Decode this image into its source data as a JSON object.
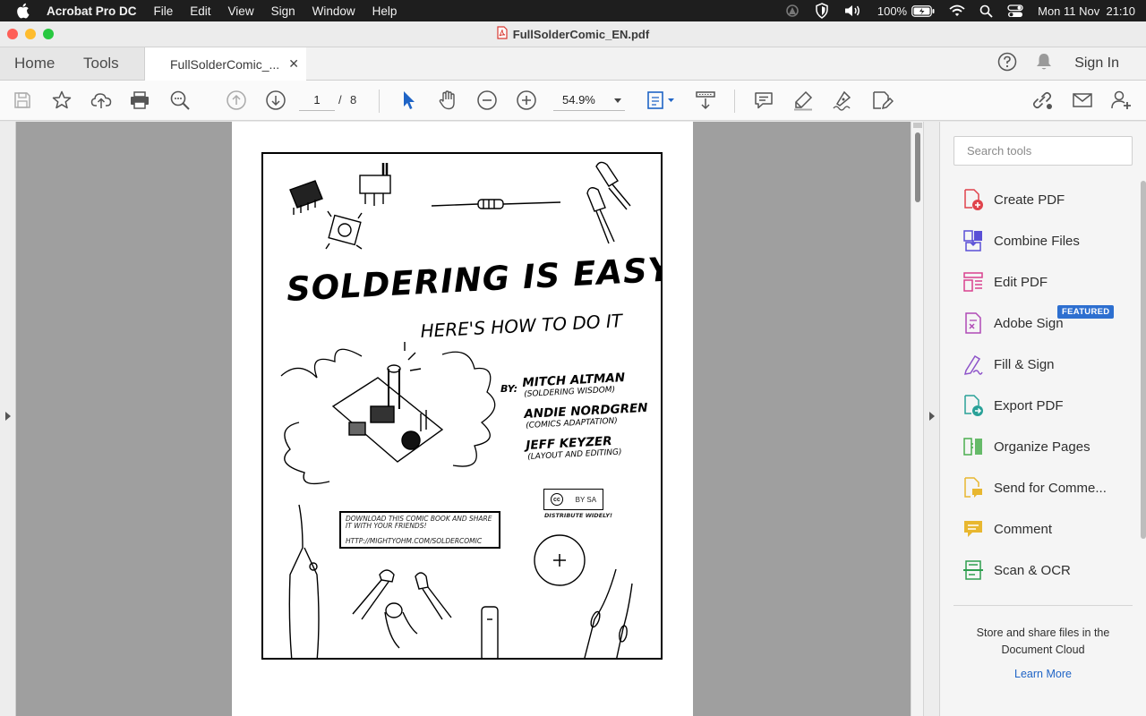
{
  "menubar": {
    "app_name": "Acrobat Pro DC",
    "items": [
      "File",
      "Edit",
      "View",
      "Sign",
      "Window",
      "Help"
    ],
    "battery": "100%",
    "datetime": "Mon 11 Nov  21:10"
  },
  "window": {
    "title": "FullSolderComic_EN.pdf"
  },
  "tabs": {
    "home": "Home",
    "tools": "Tools",
    "document": "FullSolderComic_...",
    "sign_in": "Sign In"
  },
  "toolbar": {
    "page_current": "1",
    "page_separator": "/",
    "page_total": "8",
    "zoom": "54.9%"
  },
  "document": {
    "title": "SOLDERING IS EASY",
    "subtitle": "HERE'S HOW TO DO IT",
    "by": "BY:",
    "credits": [
      {
        "name": "MITCH ALTMAN",
        "role": "(SOLDERING WISDOM)"
      },
      {
        "name": "ANDIE NORDGREN",
        "role": "(COMICS ADAPTATION)"
      },
      {
        "name": "JEFF KEYZER",
        "role": "(LAYOUT AND EDITING)"
      }
    ],
    "download_text": "DOWNLOAD THIS COMIC BOOK AND SHARE IT WITH YOUR FRIENDS!",
    "download_url": "HTTP://MIGHTYOHM.COM/SOLDERCOMIC",
    "cc_label": "BY   SA",
    "distribute": "DISTRIBUTE WIDELY!"
  },
  "tools_pane": {
    "search_placeholder": "Search tools",
    "items": [
      {
        "label": "Create PDF",
        "icon": "create-pdf-icon",
        "color": "#e0434c"
      },
      {
        "label": "Combine Files",
        "icon": "combine-files-icon",
        "color": "#5a4fd6"
      },
      {
        "label": "Edit PDF",
        "icon": "edit-pdf-icon",
        "color": "#d9418f"
      },
      {
        "label": "Adobe Sign",
        "icon": "adobe-sign-icon",
        "color": "#b04ab6",
        "badge": "FEATURED"
      },
      {
        "label": "Fill & Sign",
        "icon": "fill-sign-icon",
        "color": "#8d53c9"
      },
      {
        "label": "Export PDF",
        "icon": "export-pdf-icon",
        "color": "#2aa198"
      },
      {
        "label": "Organize Pages",
        "icon": "organize-pages-icon",
        "color": "#4caf50"
      },
      {
        "label": "Send for Comme...",
        "icon": "send-for-comment-icon",
        "color": "#e8b730"
      },
      {
        "label": "Comment",
        "icon": "comment-icon",
        "color": "#e8b730"
      },
      {
        "label": "Scan & OCR",
        "icon": "scan-ocr-icon",
        "color": "#2e9e4f"
      }
    ],
    "cloud_text": "Store and share files in the Document Cloud",
    "learn_more": "Learn More"
  }
}
